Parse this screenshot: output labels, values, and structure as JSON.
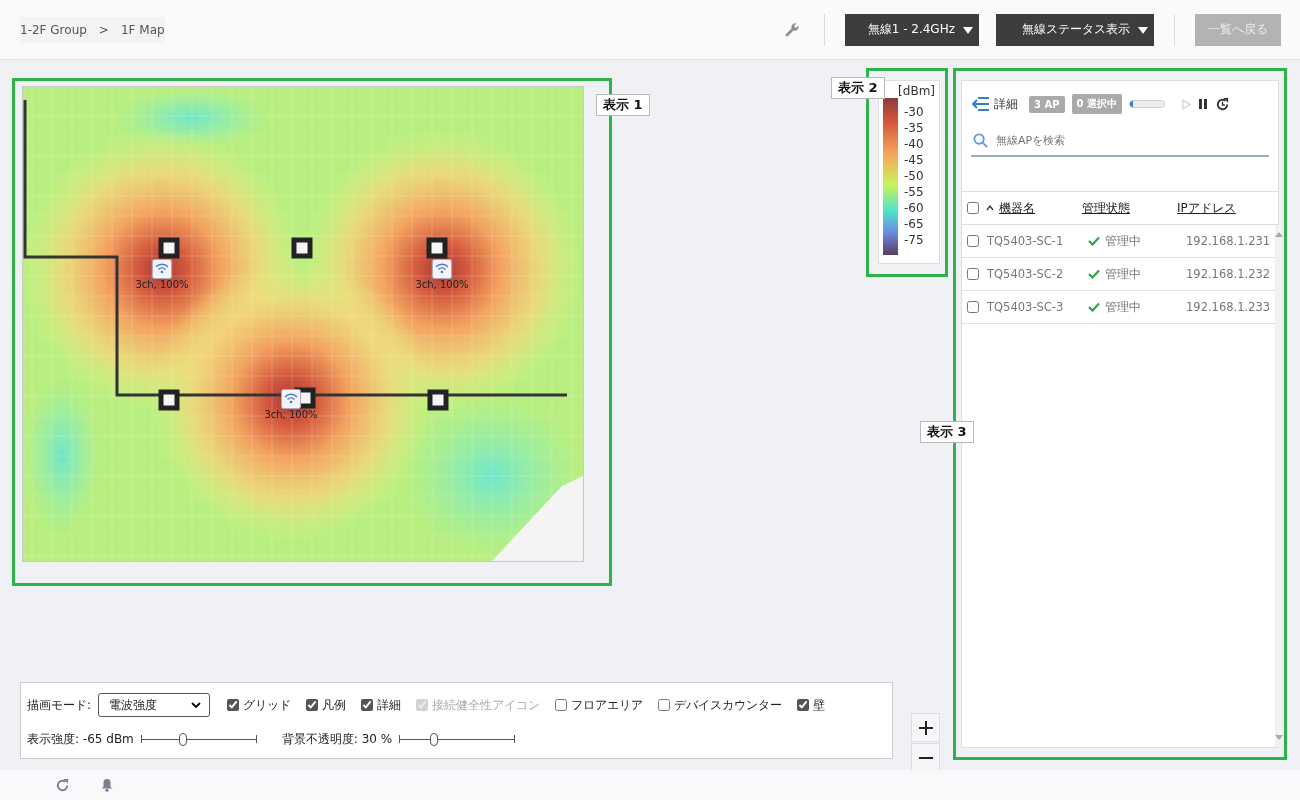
{
  "breadcrumb": [
    {
      "label": "1-2F Group"
    },
    {
      "label": ">"
    },
    {
      "label": "1F Map"
    }
  ],
  "toolbar": {
    "band_dropdown": "無線1 - 2.4GHz",
    "status_dropdown": "無線ステータス表示",
    "back_button": {
      "label": "一覧へ戻る",
      "disabled": true
    }
  },
  "annotations": [
    {
      "label": "表示 1"
    },
    {
      "label": "表示 2"
    },
    {
      "label": "表示 3"
    }
  ],
  "map": {
    "access_points": [
      {
        "label": "3ch, 100%"
      },
      {
        "label": "3ch, 100%"
      },
      {
        "label": "3ch, 100%"
      }
    ]
  },
  "legend": {
    "unit": "[dBm]",
    "ticks": [
      "-30",
      "-35",
      "-40",
      "-45",
      "-50",
      "-55",
      "-60",
      "-65",
      "-75"
    ]
  },
  "panel": {
    "title": "詳細",
    "ap_count": "3 AP",
    "selected_count": "0 選択中",
    "progress": {
      "level": 0.08
    },
    "play_disabled": true,
    "search": {
      "placeholder": "無線APを検索"
    },
    "columns": [
      "機器名",
      "管理状態",
      "IPアドレス"
    ],
    "select_all": {
      "checked": false
    },
    "rows": [
      {
        "name": "TQ5403-SC-1",
        "status": "管理中",
        "ip": "192.168.1.231",
        "checked": false
      },
      {
        "name": "TQ5403-SC-2",
        "status": "管理中",
        "ip": "192.168.1.232",
        "checked": false
      },
      {
        "name": "TQ5403-SC-3",
        "status": "管理中",
        "ip": "192.168.1.233",
        "checked": false
      }
    ]
  },
  "controls": {
    "mode_label": "描画モード:",
    "mode_value": "電波強度",
    "checkboxes": [
      {
        "label": "グリッド",
        "checked": true,
        "disabled": false
      },
      {
        "label": "凡例",
        "checked": true,
        "disabled": false
      },
      {
        "label": "詳細",
        "checked": true,
        "disabled": false
      },
      {
        "label": "接続健全性アイコン",
        "checked": true,
        "disabled": true
      },
      {
        "label": "フロアエリア",
        "checked": false,
        "disabled": false
      },
      {
        "label": "デバイスカウンター",
        "checked": false,
        "disabled": false
      },
      {
        "label": "壁",
        "checked": true,
        "disabled": false
      }
    ],
    "sliders": [
      {
        "label": "表示強度: -65 dBm",
        "level": 0.36
      },
      {
        "label": "背景不透明度: 30 %",
        "level": 0.3
      }
    ]
  }
}
